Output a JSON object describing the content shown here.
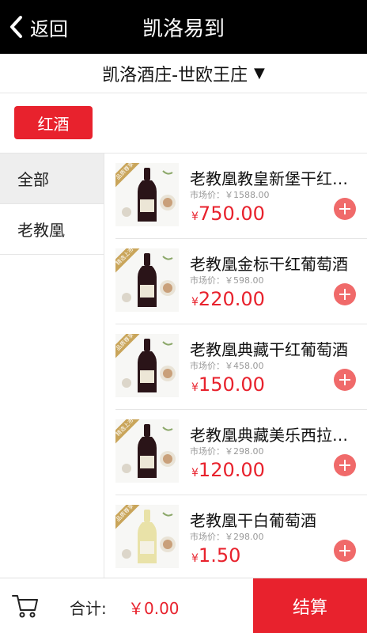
{
  "header": {
    "back_label": "返回",
    "title": "凯洛易到"
  },
  "store_selector": {
    "label": "凯洛酒庄-世欧王庄",
    "arrow": "▼"
  },
  "category_chip": {
    "label": "红酒"
  },
  "sidebar": {
    "items": [
      {
        "label": "全部"
      },
      {
        "label": "老教凰"
      }
    ]
  },
  "products": [
    {
      "name": "老教凰教皇新堡干红葡萄酒",
      "badge": "品质尊享",
      "market_price": "市场价：￥1588.00",
      "currency": "¥",
      "price": "750.00",
      "wine": "red"
    },
    {
      "name": "老教凰金标干红葡萄酒",
      "badge": "精选上市",
      "market_price": "市场价：￥598.00",
      "currency": "¥",
      "price": "220.00",
      "wine": "red"
    },
    {
      "name": "老教凰典藏干红葡萄酒",
      "badge": "品质尊享",
      "market_price": "市场价：￥458.00",
      "currency": "¥",
      "price": "150.00",
      "wine": "red"
    },
    {
      "name": "老教凰典藏美乐西拉干红",
      "badge": "精选上市",
      "market_price": "市场价：￥298.00",
      "currency": "¥",
      "price": "120.00",
      "wine": "red"
    },
    {
      "name": "老教凰干白葡萄酒",
      "badge": "品质尊享",
      "market_price": "市场价：￥298.00",
      "currency": "¥",
      "price": "1.50",
      "wine": "white"
    }
  ],
  "bottom_bar": {
    "total_label": "合计:",
    "total_value": "￥0.00",
    "checkout_label": "结算"
  },
  "colors": {
    "accent": "#e8222d",
    "header_bg": "#000000",
    "add_button": "#f06a6a"
  }
}
